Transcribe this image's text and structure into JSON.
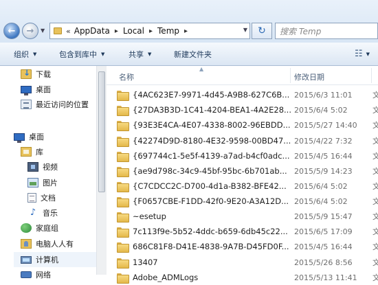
{
  "address_bar": {
    "crumb_prefix": "«",
    "crumbs": [
      "AppData",
      "Local",
      "Temp"
    ],
    "refresh_label": "↻",
    "search_placeholder": "搜索 Temp"
  },
  "toolbar": {
    "organize": "组织",
    "include_in_library": "包含到库中",
    "share": "共享",
    "new_folder": "新建文件夹"
  },
  "sidebar": {
    "items": [
      {
        "label": "下载",
        "icon": "download-folder-icon"
      },
      {
        "label": "桌面",
        "icon": "desktop-icon"
      },
      {
        "label": "最近访问的位置",
        "icon": "recent-places-icon"
      },
      {
        "label": "桌面",
        "icon": "desktop-icon"
      },
      {
        "label": "库",
        "icon": "library-icon"
      },
      {
        "label": "视频",
        "icon": "video-icon"
      },
      {
        "label": "图片",
        "icon": "picture-icon"
      },
      {
        "label": "文档",
        "icon": "documents-icon"
      },
      {
        "label": "音乐",
        "icon": "music-icon"
      },
      {
        "label": "家庭组",
        "icon": "homegroup-icon"
      },
      {
        "label": "电脑人人有",
        "icon": "user-folder-icon"
      },
      {
        "label": "计算机",
        "icon": "computer-icon"
      },
      {
        "label": "网络",
        "icon": "network-icon"
      }
    ]
  },
  "columns": {
    "name": "名称",
    "date_modified": "修改日期",
    "type_cut": "文"
  },
  "files": [
    {
      "name": "{4AC623E7-9971-4d45-A9B8-627C6B...",
      "date": "2015/6/3 11:01",
      "type": "文"
    },
    {
      "name": "{27DA3B3D-1C41-4204-BEA1-4A2E28...",
      "date": "2015/6/4 5:02",
      "type": "文"
    },
    {
      "name": "{93E3E4CA-4E07-4338-8002-96EBDD...",
      "date": "2015/5/27 14:40",
      "type": "文"
    },
    {
      "name": "{42274D9D-8180-4E32-9598-00BD47...",
      "date": "2015/4/22 7:32",
      "type": "文"
    },
    {
      "name": "{697744c1-5e5f-4139-a7ad-b4cf0adc...",
      "date": "2015/4/5 16:44",
      "type": "文"
    },
    {
      "name": "{ae9d798c-34c9-45bf-95bc-6b701ab...",
      "date": "2015/5/9 14:23",
      "type": "文"
    },
    {
      "name": "{C7CDCC2C-D700-4d1a-B382-BFE42...",
      "date": "2015/6/4 5:02",
      "type": "文"
    },
    {
      "name": "{F0657CBE-F1DD-42f0-9E20-A3A12D...",
      "date": "2015/6/4 5:02",
      "type": "文"
    },
    {
      "name": "~esetup",
      "date": "2015/5/9 15:47",
      "type": "文"
    },
    {
      "name": "7c113f9e-5b52-4ddc-b659-6db45c22...",
      "date": "2015/6/5 17:09",
      "type": "文"
    },
    {
      "name": "686C81F8-D41E-4838-9A7B-D45FD0F...",
      "date": "2015/4/5 16:44",
      "type": "文"
    },
    {
      "name": "13407",
      "date": "2015/5/26 8:56",
      "type": "文"
    },
    {
      "name": "Adobe_ADMLogs",
      "date": "2015/5/13 11:41",
      "type": "文"
    }
  ]
}
